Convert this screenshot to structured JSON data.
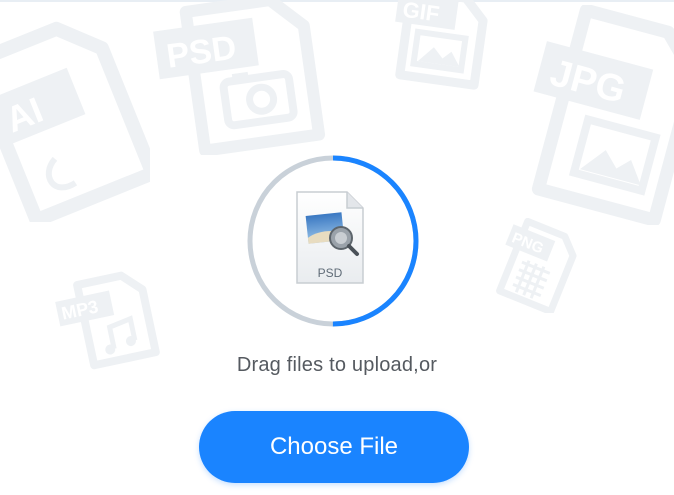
{
  "upload": {
    "instruction": "Drag files to upload,or",
    "button_label": "Choose File",
    "file_type_label": "PSD",
    "progress_fraction": 0.5
  },
  "background_icons": [
    {
      "label": "AI"
    },
    {
      "label": "PSD"
    },
    {
      "label": "GIF"
    },
    {
      "label": "JPG"
    },
    {
      "label": "PNG"
    },
    {
      "label": "MP3"
    }
  ],
  "colors": {
    "accent": "#1a84ff",
    "ring_track": "#c9d1d9",
    "deco_icon": "#f1f3f5",
    "text": "#555a60"
  }
}
